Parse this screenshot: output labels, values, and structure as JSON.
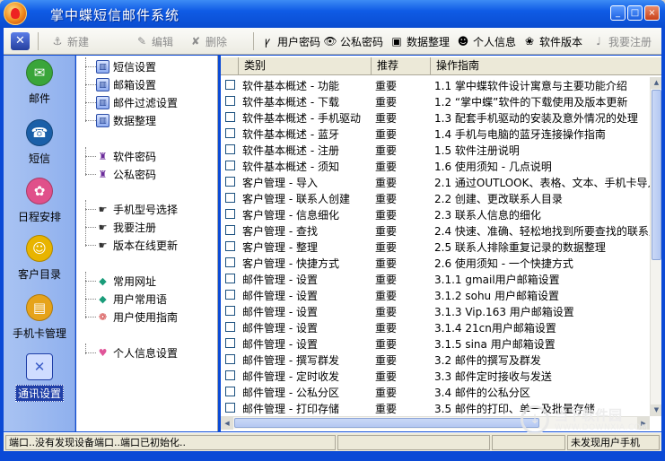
{
  "window": {
    "title": "掌中蝶短信邮件系统",
    "controls": [
      "_",
      "□",
      "×"
    ]
  },
  "toolbar": {
    "items": [
      {
        "label": "新建",
        "icon": "anchor-icon",
        "glyph": "⚓",
        "disabled": true
      },
      {
        "label": "编辑",
        "icon": "pencil-icon",
        "glyph": "✎",
        "disabled": true
      },
      {
        "label": "删除",
        "icon": "delete-icon",
        "glyph": "✘",
        "disabled": true
      },
      {
        "label": "用户密码",
        "icon": "key-icon",
        "glyph": "ꝩ",
        "disabled": false
      },
      {
        "label": "公私密码",
        "icon": "eye-icon",
        "glyph": "👁",
        "disabled": false
      },
      {
        "label": "数据整理",
        "icon": "computer-icon",
        "glyph": "▣",
        "disabled": false
      },
      {
        "label": "个人信息",
        "icon": "person-icon",
        "glyph": "☻",
        "disabled": false
      },
      {
        "label": "软件版本",
        "icon": "butterfly-icon",
        "glyph": "❀",
        "disabled": false
      },
      {
        "label": "我要注册",
        "icon": "register-icon",
        "glyph": "♩",
        "disabled": true
      }
    ]
  },
  "nav": {
    "items": [
      {
        "label": "邮件",
        "icon": "envelope-icon",
        "glyph": "✉",
        "color": "#3aa53a",
        "active": false
      },
      {
        "label": "短信",
        "icon": "mobile-phone-icon",
        "glyph": "☎",
        "color": "#1a5fa8",
        "active": false
      },
      {
        "label": "日程安排",
        "icon": "calendar-icon",
        "glyph": "✿",
        "color": "#e0508a",
        "active": false
      },
      {
        "label": "客户目录",
        "icon": "smiley-icon",
        "glyph": "☺",
        "color": "#e8b400",
        "active": false
      },
      {
        "label": "手机卡管理",
        "icon": "sim-card-icon",
        "glyph": "▤",
        "color": "#e6a31a",
        "active": false
      },
      {
        "label": "通讯设置",
        "icon": "tools-icon",
        "glyph": "✕",
        "color": "#3a5cc7",
        "active": true
      }
    ]
  },
  "tree": {
    "groups": [
      [
        {
          "label": "短信设置",
          "icon": "book-icon",
          "glyph": "▥",
          "style": "book"
        },
        {
          "label": "邮箱设置",
          "icon": "book-icon",
          "glyph": "▥",
          "style": "book"
        },
        {
          "label": "邮件过滤设置",
          "icon": "book-icon",
          "glyph": "▥",
          "style": "book"
        },
        {
          "label": "数据整理",
          "icon": "book-icon",
          "glyph": "▥",
          "style": "book"
        }
      ],
      [
        {
          "label": "软件密码",
          "icon": "crest-icon",
          "glyph": "♜",
          "style": "crest"
        },
        {
          "label": "公私密码",
          "icon": "crest-icon",
          "glyph": "♜",
          "style": "crest"
        }
      ],
      [
        {
          "label": "手机型号选择",
          "icon": "pointer-hand-icon",
          "glyph": "☛",
          "style": "hand"
        },
        {
          "label": "我要注册",
          "icon": "pointer-hand-icon",
          "glyph": "☛",
          "style": "hand"
        },
        {
          "label": "版本在线更新",
          "icon": "pointer-hand-icon",
          "glyph": "☛",
          "style": "hand"
        }
      ],
      [
        {
          "label": "常用网址",
          "icon": "diamond-icon",
          "glyph": "◆",
          "style": "gem"
        },
        {
          "label": "用户常用语",
          "icon": "diamond-icon",
          "glyph": "◆",
          "style": "gem"
        },
        {
          "label": "用户使用指南",
          "icon": "flower-icon",
          "glyph": "❁",
          "style": "flower"
        }
      ],
      [
        {
          "label": "个人信息设置",
          "icon": "pig-icon",
          "glyph": "♥",
          "style": "heart"
        }
      ]
    ]
  },
  "grid": {
    "columns": [
      "类别",
      "推荐",
      "操作指南"
    ],
    "rows": [
      [
        "软件基本概述 - 功能",
        "重要",
        "1.1 掌中蝶软件设计寓意与主要功能介绍"
      ],
      [
        "软件基本概述 - 下载",
        "重要",
        "1.2 “掌中蝶”软件的下载使用及版本更新"
      ],
      [
        "软件基本概述 - 手机驱动",
        "重要",
        "1.3 配套手机驱动的安装及意外情况的处理"
      ],
      [
        "软件基本概述 - 蓝牙",
        "重要",
        "1.4 手机与电脑的蓝牙连接操作指南"
      ],
      [
        "软件基本概述 - 注册",
        "重要",
        "1.5 软件注册说明"
      ],
      [
        "软件基本概述 - 须知",
        "重要",
        "1.6 使用须知 - 几点说明"
      ],
      [
        "客户管理 - 导入",
        "重要",
        "2.1 通过OUTLOOK、表格、文本、手机卡导入"
      ],
      [
        "客户管理 - 联系人创建",
        "重要",
        "2.2 创建、更改联系人目录"
      ],
      [
        "客户管理 - 信息细化",
        "重要",
        "2.3 联系人信息的细化"
      ],
      [
        "客户管理 - 查找",
        "重要",
        "2.4 快速、准确、轻松地找到所要查找的联系人"
      ],
      [
        "客户管理 - 整理",
        "重要",
        "2.5 联系人排除重复记录的数据整理"
      ],
      [
        "客户管理 - 快捷方式",
        "重要",
        "2.6 使用须知 - 一个快捷方式"
      ],
      [
        "邮件管理 - 设置",
        "重要",
        "3.1.1 gmail用户邮箱设置"
      ],
      [
        "邮件管理 - 设置",
        "重要",
        "3.1.2 sohu 用户邮箱设置"
      ],
      [
        "邮件管理 - 设置",
        "重要",
        "3.1.3 Vip.163 用户邮箱设置"
      ],
      [
        "邮件管理 - 设置",
        "重要",
        "3.1.4 21cn用户邮箱设置"
      ],
      [
        "邮件管理 - 设置",
        "重要",
        "3.1.5 sina 用户邮箱设置"
      ],
      [
        "邮件管理 - 撰写群发",
        "重要",
        "3.2 邮件的撰写及群发"
      ],
      [
        "邮件管理 - 定时收发",
        "重要",
        "3.3 邮件定时接收与发送"
      ],
      [
        "邮件管理 - 公私分区",
        "重要",
        "3.4 邮件的公私分区"
      ],
      [
        "邮件管理 - 打印存储",
        "重要",
        "3.5 邮件的打印、单一及批量存储"
      ]
    ]
  },
  "status": {
    "left": "端口..没有发现设备端口..端口已初始化..",
    "right": "未发现用户手机"
  },
  "watermark": {
    "text": "当下软件园",
    "sub": "WWW.DOWNXIA.COM"
  }
}
